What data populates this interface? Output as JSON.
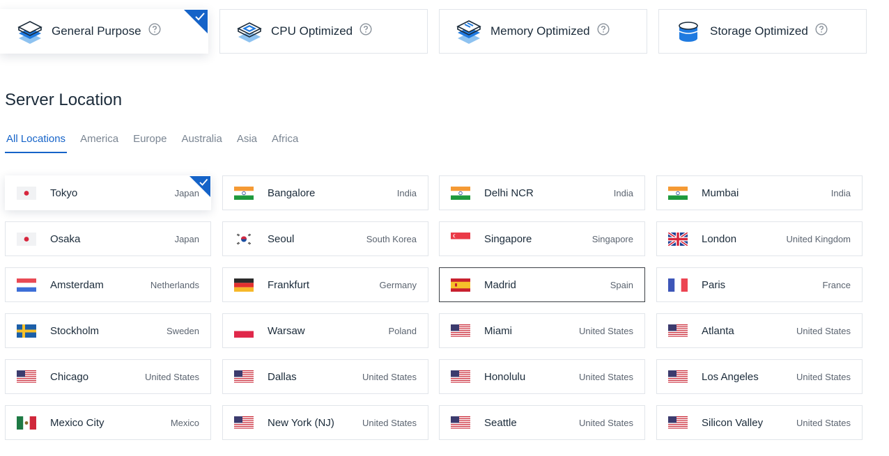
{
  "plans": [
    {
      "title": "General Purpose",
      "icon": "stack-layers-icon",
      "selected": true
    },
    {
      "title": "CPU Optimized",
      "icon": "cpu-chip-icon",
      "selected": false
    },
    {
      "title": "Memory Optimized",
      "icon": "memory-module-icon",
      "selected": false
    },
    {
      "title": "Storage Optimized",
      "icon": "storage-disk-icon",
      "selected": false
    }
  ],
  "section_title": "Server Location",
  "tabs": [
    "All Locations",
    "America",
    "Europe",
    "Australia",
    "Asia",
    "Africa"
  ],
  "active_tab": "All Locations",
  "accent_color": "#1563c8",
  "locations": [
    {
      "city": "Tokyo",
      "country": "Japan",
      "flag": "jp",
      "selected": true
    },
    {
      "city": "Bangalore",
      "country": "India",
      "flag": "in"
    },
    {
      "city": "Delhi NCR",
      "country": "India",
      "flag": "in"
    },
    {
      "city": "Mumbai",
      "country": "India",
      "flag": "in"
    },
    {
      "city": "Osaka",
      "country": "Japan",
      "flag": "jp"
    },
    {
      "city": "Seoul",
      "country": "South Korea",
      "flag": "kr"
    },
    {
      "city": "Singapore",
      "country": "Singapore",
      "flag": "sg"
    },
    {
      "city": "London",
      "country": "United Kingdom",
      "flag": "gb"
    },
    {
      "city": "Amsterdam",
      "country": "Netherlands",
      "flag": "nl"
    },
    {
      "city": "Frankfurt",
      "country": "Germany",
      "flag": "de"
    },
    {
      "city": "Madrid",
      "country": "Spain",
      "flag": "es",
      "hover": true
    },
    {
      "city": "Paris",
      "country": "France",
      "flag": "fr"
    },
    {
      "city": "Stockholm",
      "country": "Sweden",
      "flag": "se"
    },
    {
      "city": "Warsaw",
      "country": "Poland",
      "flag": "pl"
    },
    {
      "city": "Miami",
      "country": "United States",
      "flag": "us"
    },
    {
      "city": "Atlanta",
      "country": "United States",
      "flag": "us"
    },
    {
      "city": "Chicago",
      "country": "United States",
      "flag": "us"
    },
    {
      "city": "Dallas",
      "country": "United States",
      "flag": "us"
    },
    {
      "city": "Honolulu",
      "country": "United States",
      "flag": "us"
    },
    {
      "city": "Los Angeles",
      "country": "United States",
      "flag": "us"
    },
    {
      "city": "Mexico City",
      "country": "Mexico",
      "flag": "mx"
    },
    {
      "city": "New York (NJ)",
      "country": "United States",
      "flag": "us"
    },
    {
      "city": "Seattle",
      "country": "United States",
      "flag": "us"
    },
    {
      "city": "Silicon Valley",
      "country": "United States",
      "flag": "us"
    }
  ]
}
